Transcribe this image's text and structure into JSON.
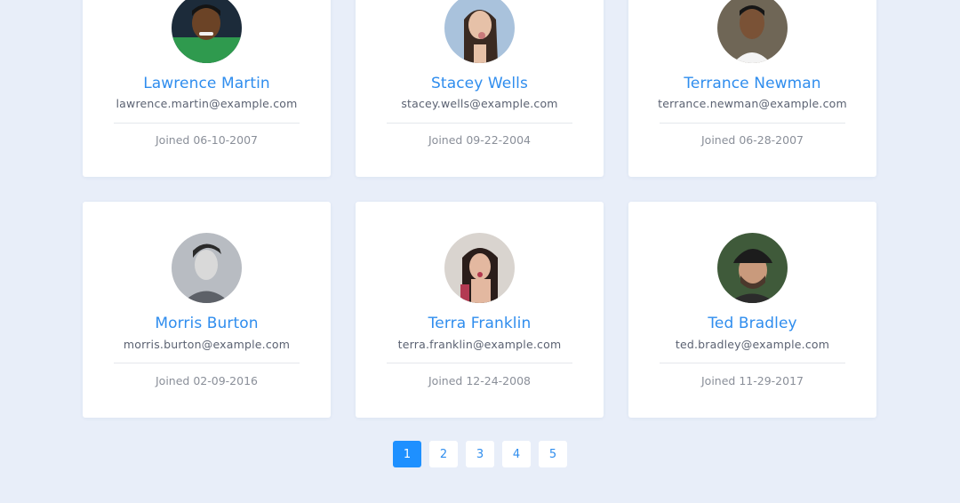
{
  "users": [
    {
      "name": "Lawrence Martin",
      "email": "lawrence.martin@example.com",
      "joined": "Joined 06-10-2007",
      "avatar_icon": "user-photo-icon"
    },
    {
      "name": "Stacey Wells",
      "email": "stacey.wells@example.com",
      "joined": "Joined 09-22-2004",
      "avatar_icon": "user-photo-icon"
    },
    {
      "name": "Terrance Newman",
      "email": "terrance.newman@example.com",
      "joined": "Joined 06-28-2007",
      "avatar_icon": "user-photo-icon"
    },
    {
      "name": "Morris Burton",
      "email": "morris.burton@example.com",
      "joined": "Joined 02-09-2016",
      "avatar_icon": "user-photo-icon"
    },
    {
      "name": "Terra Franklin",
      "email": "terra.franklin@example.com",
      "joined": "Joined 12-24-2008",
      "avatar_icon": "user-photo-icon"
    },
    {
      "name": "Ted Bradley",
      "email": "ted.bradley@example.com",
      "joined": "Joined 11-29-2017",
      "avatar_icon": "user-photo-icon"
    }
  ],
  "pagination": {
    "pages": [
      "1",
      "2",
      "3",
      "4",
      "5"
    ],
    "active": "1"
  },
  "colors": {
    "accent": "#1e90ff",
    "name_text": "#2f8dee",
    "background": "#e8eef9"
  }
}
